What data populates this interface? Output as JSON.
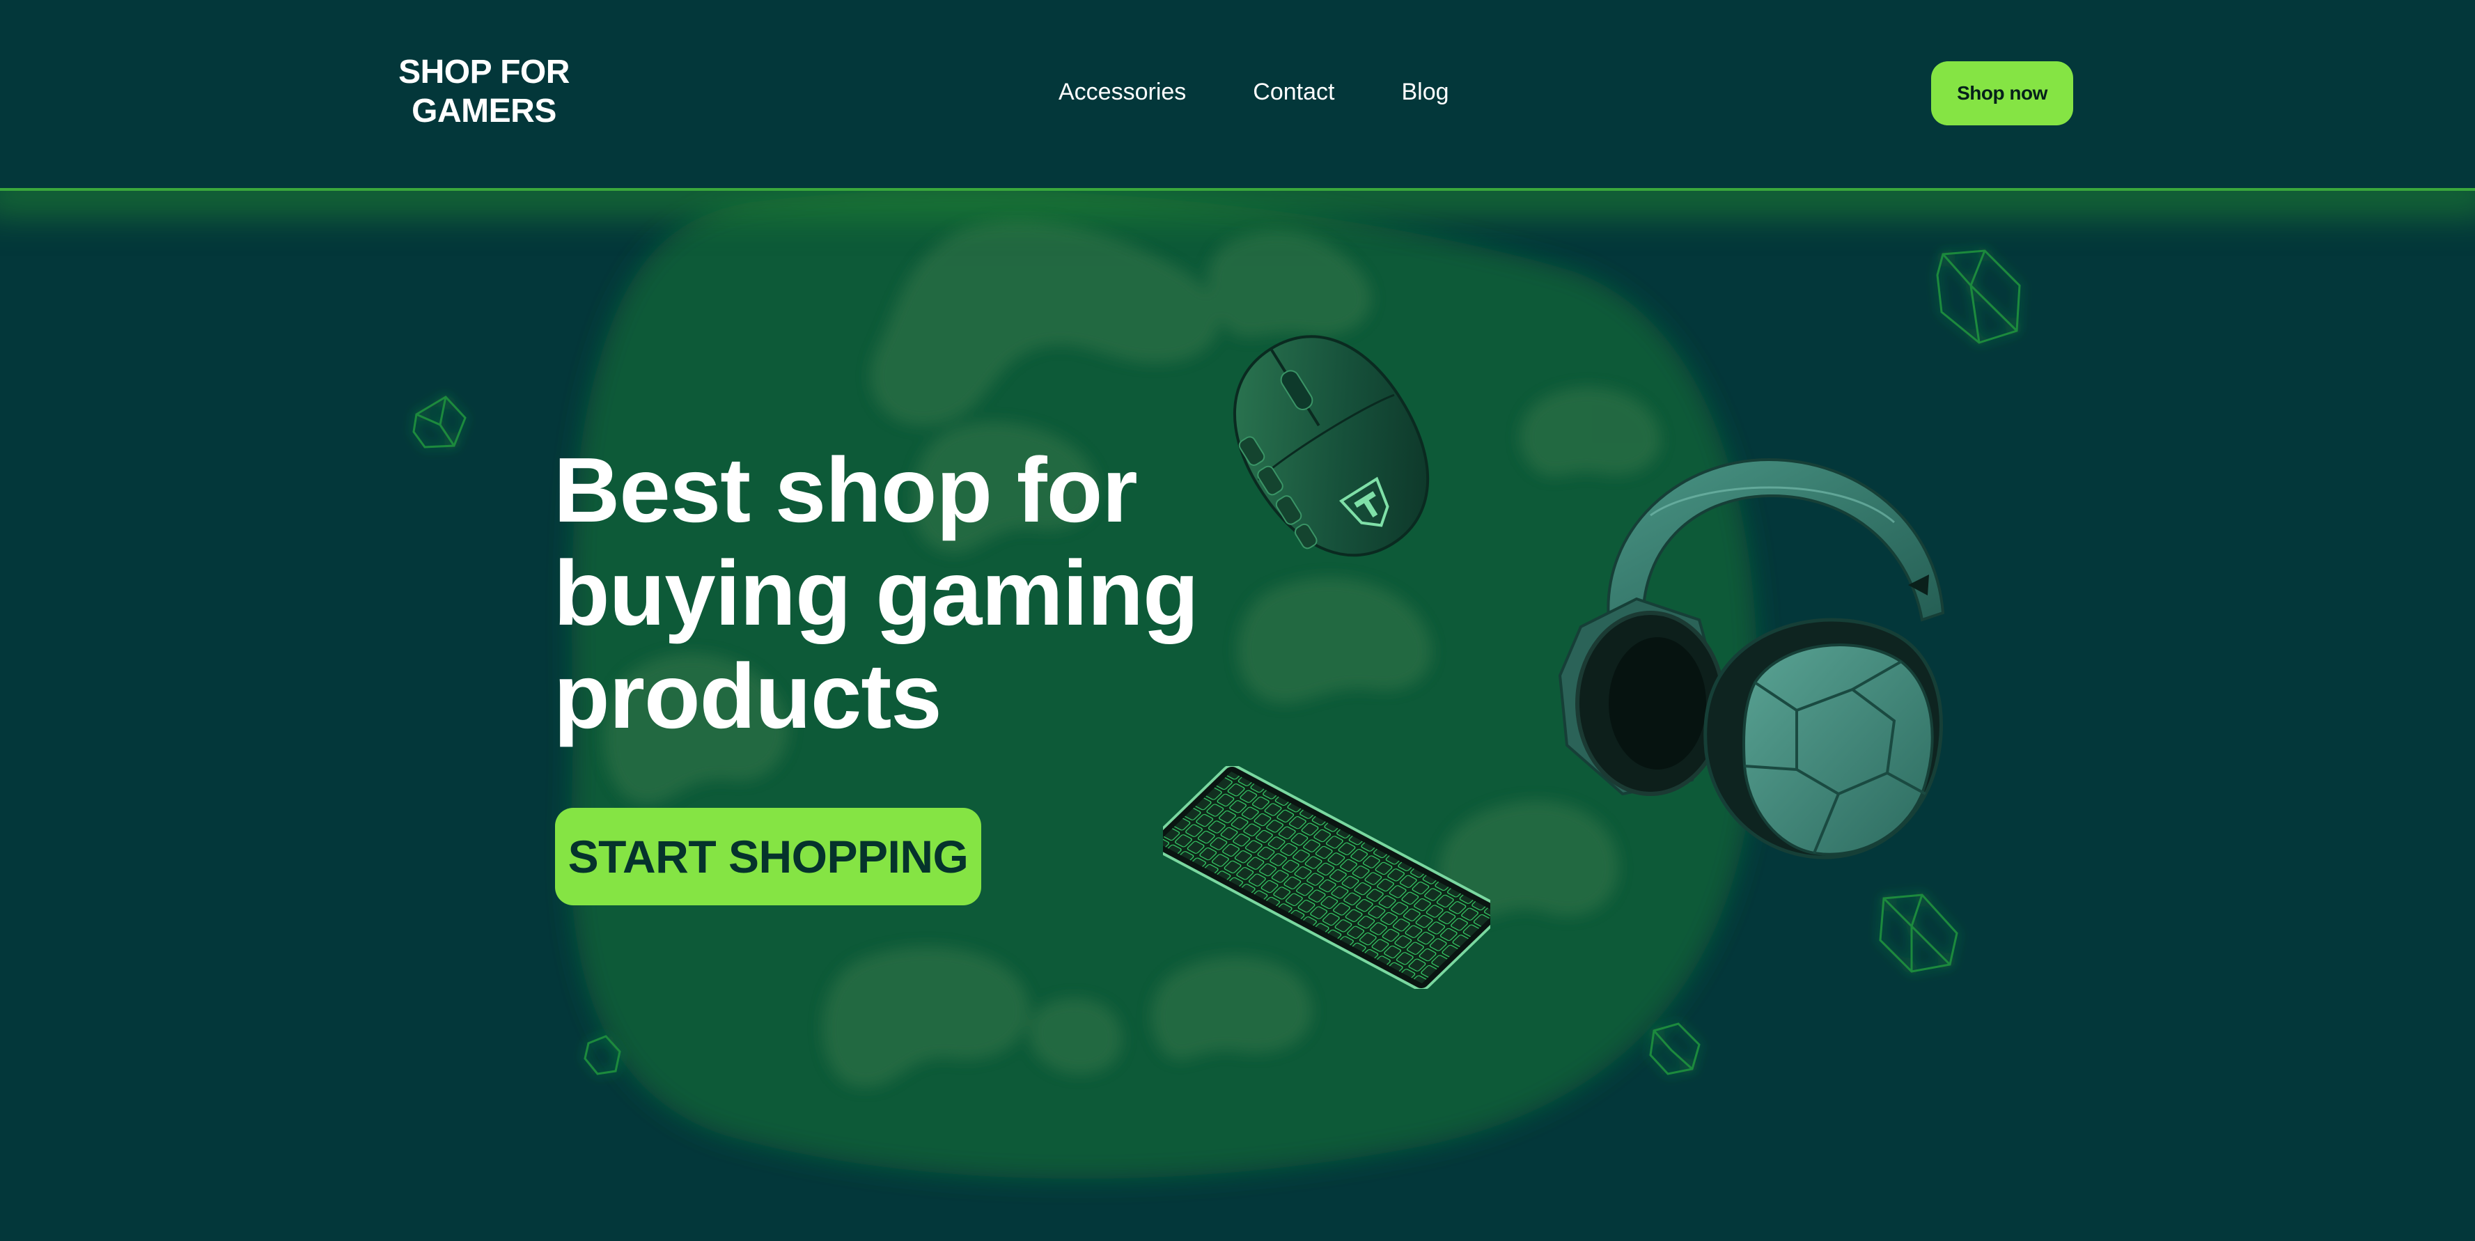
{
  "header": {
    "logo_line1": "SHOP FOR",
    "logo_line2": "GAMERS",
    "nav": [
      {
        "label": "Accessories"
      },
      {
        "label": "Contact"
      },
      {
        "label": "Blog"
      }
    ],
    "cta_label": "Shop now"
  },
  "hero": {
    "headline_line1": "Best shop for",
    "headline_line2": "buying gaming",
    "headline_line3": "products",
    "cta_label": "START SHOPPING",
    "products": [
      "gaming-mouse",
      "gaming-headphones",
      "gaming-keyboard"
    ]
  },
  "colors": {
    "background": "#03373a",
    "accent": "#85e444",
    "blob": "#0b5a38",
    "text": "#ffffff"
  }
}
